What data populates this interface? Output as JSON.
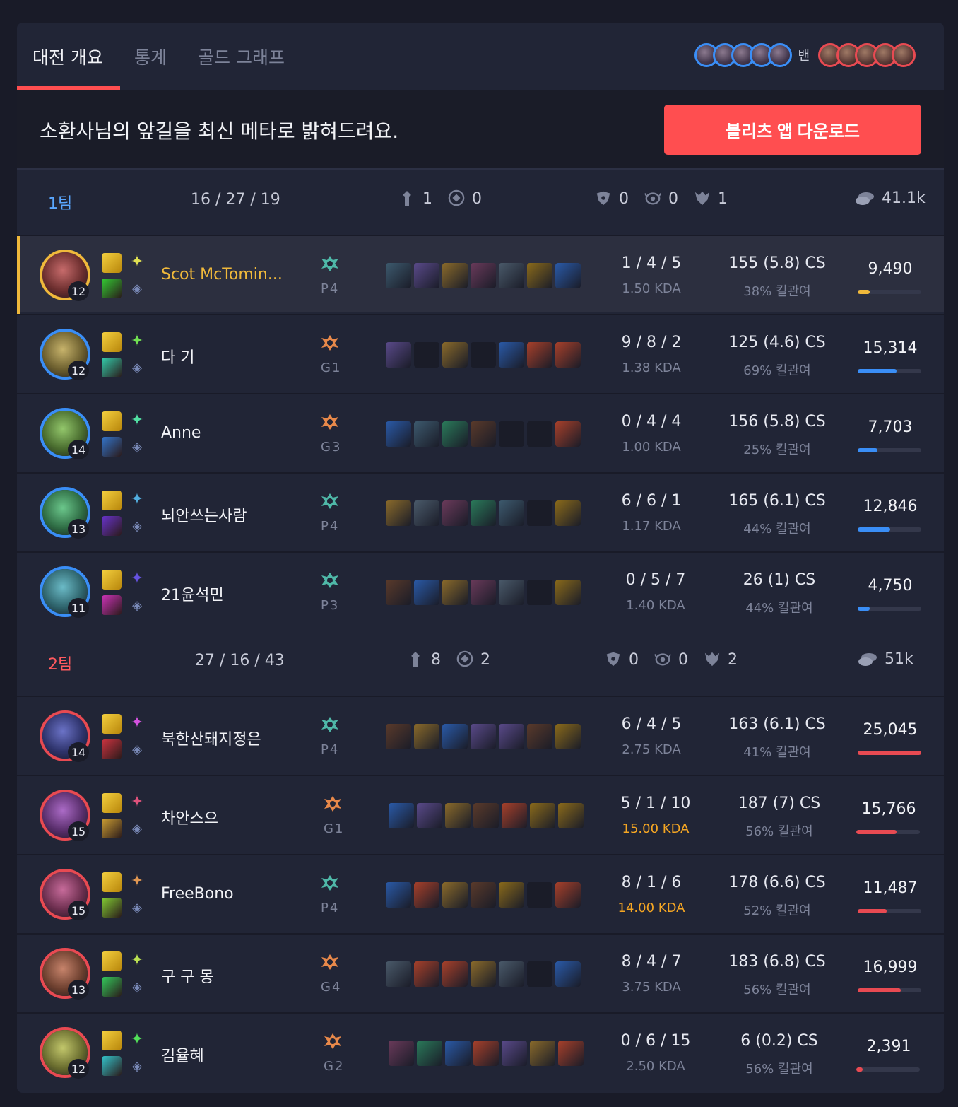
{
  "tabs": [
    {
      "label": "대전 개요",
      "active": true
    },
    {
      "label": "통계",
      "active": false
    },
    {
      "label": "골드 그래프",
      "active": false
    }
  ],
  "bans": {
    "label": "밴",
    "blue_count": 5,
    "red_count": 5
  },
  "banner": {
    "text": "소환사님의 앞길을 최신 메타로 밝혀드려요.",
    "button": "블리츠 앱 다운로드"
  },
  "colors": {
    "accent": "#ff4e50",
    "blue": "#3a8ef6",
    "red": "#e84a52",
    "gold": "#f0b93b",
    "team1_label": "#5aa7ff",
    "team2_label": "#ff5a5f"
  },
  "teams": [
    {
      "name": "1팀",
      "kda": "16 / 27 / 19",
      "towers": "1",
      "inhibitors": "0",
      "barons": "0",
      "heralds": "0",
      "dragons": "1",
      "gold": "41.1k",
      "players": [
        {
          "name": "Scot McTomin...",
          "level": "12",
          "tier": "P4",
          "kda": "1 / 4 / 5",
          "ratio": "1.50 KDA",
          "cs": "155 (5.8) CS",
          "kp": "38% 킬관여",
          "damage": "9,490",
          "damage_pct": 0.19,
          "me": true
        },
        {
          "name": "다 기",
          "level": "12",
          "tier": "G1",
          "kda": "9 / 8 / 2",
          "ratio": "1.38 KDA",
          "cs": "125 (4.6) CS",
          "kp": "69% 킬관여",
          "damage": "15,314",
          "damage_pct": 0.61
        },
        {
          "name": "Anne",
          "level": "14",
          "tier": "G3",
          "kda": "0 / 4 / 4",
          "ratio": "1.00 KDA",
          "cs": "156 (5.8) CS",
          "kp": "25% 킬관여",
          "damage": "7,703",
          "damage_pct": 0.31
        },
        {
          "name": "뇌안쓰는사람",
          "level": "13",
          "tier": "P4",
          "kda": "6 / 6 / 1",
          "ratio": "1.17 KDA",
          "cs": "165 (6.1) CS",
          "kp": "44% 킬관여",
          "damage": "12,846",
          "damage_pct": 0.51
        },
        {
          "name": "21윤석민",
          "level": "11",
          "tier": "P3",
          "kda": "0 / 5 / 7",
          "ratio": "1.40 KDA",
          "cs": "26 (1) CS",
          "kp": "44% 킬관여",
          "damage": "4,750",
          "damage_pct": 0.19
        }
      ]
    },
    {
      "name": "2팀",
      "kda": "27 / 16 / 43",
      "towers": "8",
      "inhibitors": "2",
      "barons": "0",
      "heralds": "0",
      "dragons": "2",
      "gold": "51k",
      "players": [
        {
          "name": "북한산돼지정은",
          "level": "14",
          "tier": "P4",
          "kda": "6 / 4 / 5",
          "ratio": "2.75 KDA",
          "cs": "163 (6.1) CS",
          "kp": "41% 킬관여",
          "damage": "25,045",
          "damage_pct": 1.0
        },
        {
          "name": "차안스으",
          "level": "15",
          "tier": "G1",
          "kda": "5 / 1 / 10",
          "ratio": "15.00 KDA",
          "cs": "187 (7) CS",
          "kp": "56% 킬관여",
          "damage": "15,766",
          "damage_pct": 0.63
        },
        {
          "name": "FreeBono",
          "level": "15",
          "tier": "P4",
          "kda": "8 / 1 / 6",
          "ratio": "14.00 KDA",
          "cs": "178 (6.6) CS",
          "kp": "52% 킬관여",
          "damage": "11,487",
          "damage_pct": 0.46
        },
        {
          "name": "구 구 몽",
          "level": "13",
          "tier": "G4",
          "kda": "8 / 4 / 7",
          "ratio": "3.75 KDA",
          "cs": "183 (6.8) CS",
          "kp": "56% 킬관여",
          "damage": "16,999",
          "damage_pct": 0.68
        },
        {
          "name": "김율혜",
          "level": "12",
          "tier": "G2",
          "kda": "0 / 6 / 15",
          "ratio": "2.50 KDA",
          "cs": "6 (0.2) CS",
          "kp": "56% 킬관여",
          "damage": "2,391",
          "damage_pct": 0.1
        }
      ]
    }
  ]
}
